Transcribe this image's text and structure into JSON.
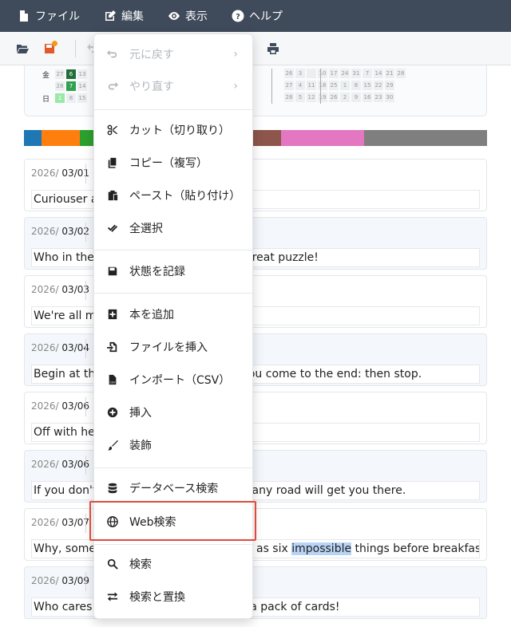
{
  "menubar": {
    "file": "ファイル",
    "edit": "編集",
    "view": "表示",
    "help": "ヘルプ"
  },
  "calendar": {
    "rows": [
      {
        "day": "金",
        "cells": [
          "27",
          "6",
          "13",
          "",
          "",
          "",
          "",
          "",
          "",
          "",
          "",
          "",
          "",
          "",
          "",
          "",
          "",
          ""
        ],
        "right": [
          "26",
          "3",
          "",
          "10",
          "17",
          "24",
          "31",
          "7",
          "14",
          "21",
          "28"
        ]
      },
      {
        "day": "",
        "cells": [
          "28",
          "7",
          "14",
          "",
          "",
          "",
          "",
          "",
          "",
          "",
          "",
          "",
          "",
          "",
          "",
          "",
          "",
          ""
        ],
        "right": [
          "27",
          "4",
          "11",
          "18",
          "25",
          "1",
          "8",
          "15",
          "22",
          "29"
        ]
      },
      {
        "day": "日",
        "cells": [
          "1",
          "8",
          "15",
          "",
          "",
          "",
          "",
          "",
          "",
          "",
          "",
          "",
          "",
          "",
          "",
          "",
          "",
          ""
        ],
        "right": [
          "28",
          "5",
          "12",
          "19",
          "26",
          "2",
          "9",
          "16",
          "23",
          "30"
        ]
      }
    ]
  },
  "colorbar": [
    "#1f77b4",
    "#ff7f0e",
    "#2ca02c",
    "#d62728",
    "#9467bd",
    "#8c564b",
    "#e377c2",
    "#7f7f7f"
  ],
  "entries": [
    {
      "year": "2026/",
      "md": "03/01",
      "text": "Curiouser and curiouser!"
    },
    {
      "year": "2026/",
      "md": "03/02",
      "text_a": "Who in the world am I? Ah, that's the great puzzle!"
    },
    {
      "year": "2026/",
      "md": "03/03",
      "text": "We're all mad here."
    },
    {
      "year": "2026/",
      "md": "03/04",
      "text": "Begin at the beginning and go on till you come to the end: then stop."
    },
    {
      "year": "2026/",
      "md": "03/06",
      "text": "Off with her head!"
    },
    {
      "year": "2026/",
      "md": "03/06",
      "text": "If you don't know where you are going any road will get you there."
    },
    {
      "year": "2026/",
      "md": "03/07",
      "text_pre": "Why, sometimes I've believed as many as six ",
      "text_hl": "impossible",
      "text_post": " things before breakfast."
    },
    {
      "year": "2026/",
      "md": "03/09",
      "text": "Who cares for you? You're nothing but a pack of cards!"
    }
  ],
  "dropdown": {
    "undo": "元に戻す",
    "redo": "やり直す",
    "cut": "カット（切り取り）",
    "copy": "コピー（複写）",
    "paste": "ペースト（貼り付け）",
    "select_all": "全選択",
    "save_state": "状態を記録",
    "add_book": "本を追加",
    "insert_file": "ファイルを挿入",
    "import_csv": "インポート（CSV）",
    "insert": "挿入",
    "decorate": "装飾",
    "db_search": "データベース検索",
    "web_search": "Web検索",
    "search": "検索",
    "search_replace": "検索と置換",
    "chevron": "›"
  }
}
